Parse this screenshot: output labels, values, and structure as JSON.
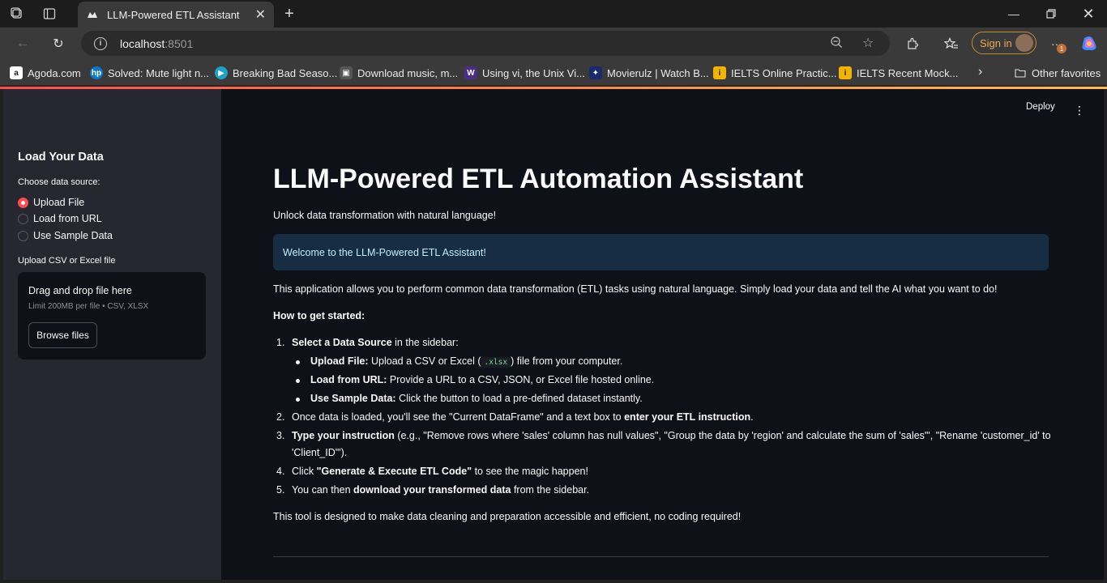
{
  "browser": {
    "tab_title": "LLM-Powered ETL Assistant",
    "url_host": "localhost",
    "url_port": ":8501",
    "signin_label": "Sign in",
    "notification_count": "1",
    "bookmarks": [
      {
        "label": "Agoda.com"
      },
      {
        "label": "Solved: Mute light n..."
      },
      {
        "label": "Breaking Bad Seaso..."
      },
      {
        "label": "Download music, m..."
      },
      {
        "label": "Using vi, the Unix Vi..."
      },
      {
        "label": "Movierulz | Watch B..."
      },
      {
        "label": "IELTS Online Practic..."
      },
      {
        "label": "IELTS Recent Mock..."
      }
    ],
    "other_favorites": "Other favorites"
  },
  "sidebar": {
    "heading": "Load Your Data",
    "source_label": "Choose data source:",
    "options": [
      {
        "label": "Upload File",
        "selected": true
      },
      {
        "label": "Load from URL",
        "selected": false
      },
      {
        "label": "Use Sample Data",
        "selected": false
      }
    ],
    "upload_label": "Upload CSV or Excel file",
    "drop_text": "Drag and drop file here",
    "limit_text": "Limit 200MB per file • CSV, XLSX",
    "browse_label": "Browse files"
  },
  "header": {
    "deploy_label": "Deploy"
  },
  "main": {
    "title": "LLM-Powered ETL Automation Assistant",
    "subtitle": "Unlock data transformation with natural language!",
    "info": "Welcome to the LLM-Powered ETL Assistant!",
    "intro": "This application allows you to perform common data transformation (ETL) tasks using natural language. Simply load your data and tell the AI what you want to do!",
    "how_heading": "How to get started:",
    "step1_bold": "Select a Data Source",
    "step1_rest": " in the sidebar:",
    "sub1_bold": "Upload File:",
    "sub1_pre": " Upload a CSV or Excel (",
    "sub1_code": ".xlsx",
    "sub1_post": ") file from your computer.",
    "sub2_bold": "Load from URL:",
    "sub2_rest": " Provide a URL to a CSV, JSON, or Excel file hosted online.",
    "sub3_bold": "Use Sample Data:",
    "sub3_rest": " Click the button to load a pre-defined dataset instantly.",
    "step2_pre": "Once data is loaded, you'll see the \"Current DataFrame\" and a text box to ",
    "step2_bold": "enter your ETL instruction",
    "step2_post": ".",
    "step3_bold": "Type your instruction",
    "step3_rest": " (e.g., \"Remove rows where 'sales' column has null values\", \"Group the data by 'region' and calculate the sum of 'sales'\", \"Rename 'customer_id' to",
    "step3_cont": "'Client_ID'\").",
    "step4_pre": "Click ",
    "step4_bold": "\"Generate & Execute ETL Code\"",
    "step4_post": " to see the magic happen!",
    "step5_pre": "You can then ",
    "step5_bold": "download your transformed data",
    "step5_post": " from the sidebar.",
    "outro": "This tool is designed to make data cleaning and preparation accessible and efficient, no coding required!"
  }
}
